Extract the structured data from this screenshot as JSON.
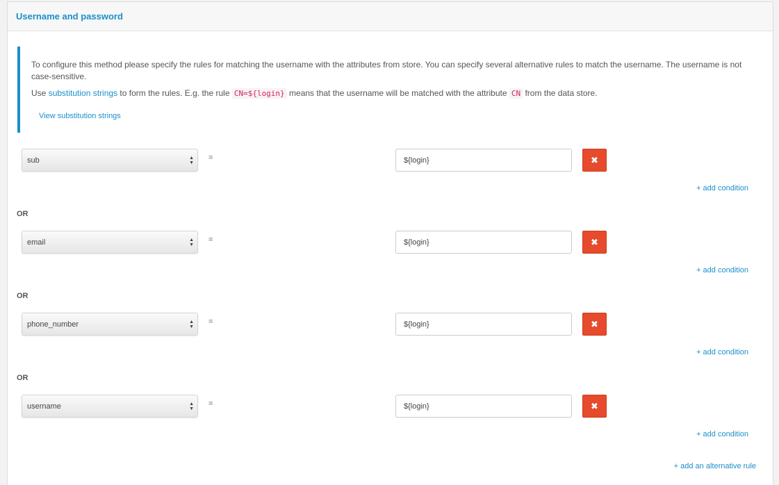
{
  "panel": {
    "title": "Username and password"
  },
  "info": {
    "line1": "To configure this method please specify the rules for matching the username with the attributes from store. You can specify several alternative rules to match the username. The username is not case-sensitive.",
    "line2_prefix": "Use ",
    "line2_link": "substitution strings",
    "line2_mid1": " to form the rules. E.g. the rule ",
    "code_rule": "CN=${login}",
    "line2_mid2": " means that the username will be matched with the attribute ",
    "code_attr": "CN",
    "line2_suffix": " from the data store.",
    "view_link": "View substitution strings"
  },
  "rules": [
    {
      "attribute": "sub",
      "operator": "=",
      "value": "${login}",
      "delete_icon": "close-icon",
      "add_condition": "+ add condition"
    },
    {
      "attribute": "email",
      "operator": "=",
      "value": "${login}",
      "delete_icon": "close-icon",
      "add_condition": "+ add condition"
    },
    {
      "attribute": "phone_number",
      "operator": "=",
      "value": "${login}",
      "delete_icon": "close-icon",
      "add_condition": "+ add condition"
    },
    {
      "attribute": "username",
      "operator": "=",
      "value": "${login}",
      "delete_icon": "close-icon",
      "add_condition": "+ add condition"
    }
  ],
  "or_labels": [
    "OR",
    "OR",
    "OR"
  ],
  "add_alternative": "+ add an alternative rule",
  "colors": {
    "accent": "#1a8fc9",
    "danger": "#e54b2c",
    "code": "#d7245b"
  }
}
